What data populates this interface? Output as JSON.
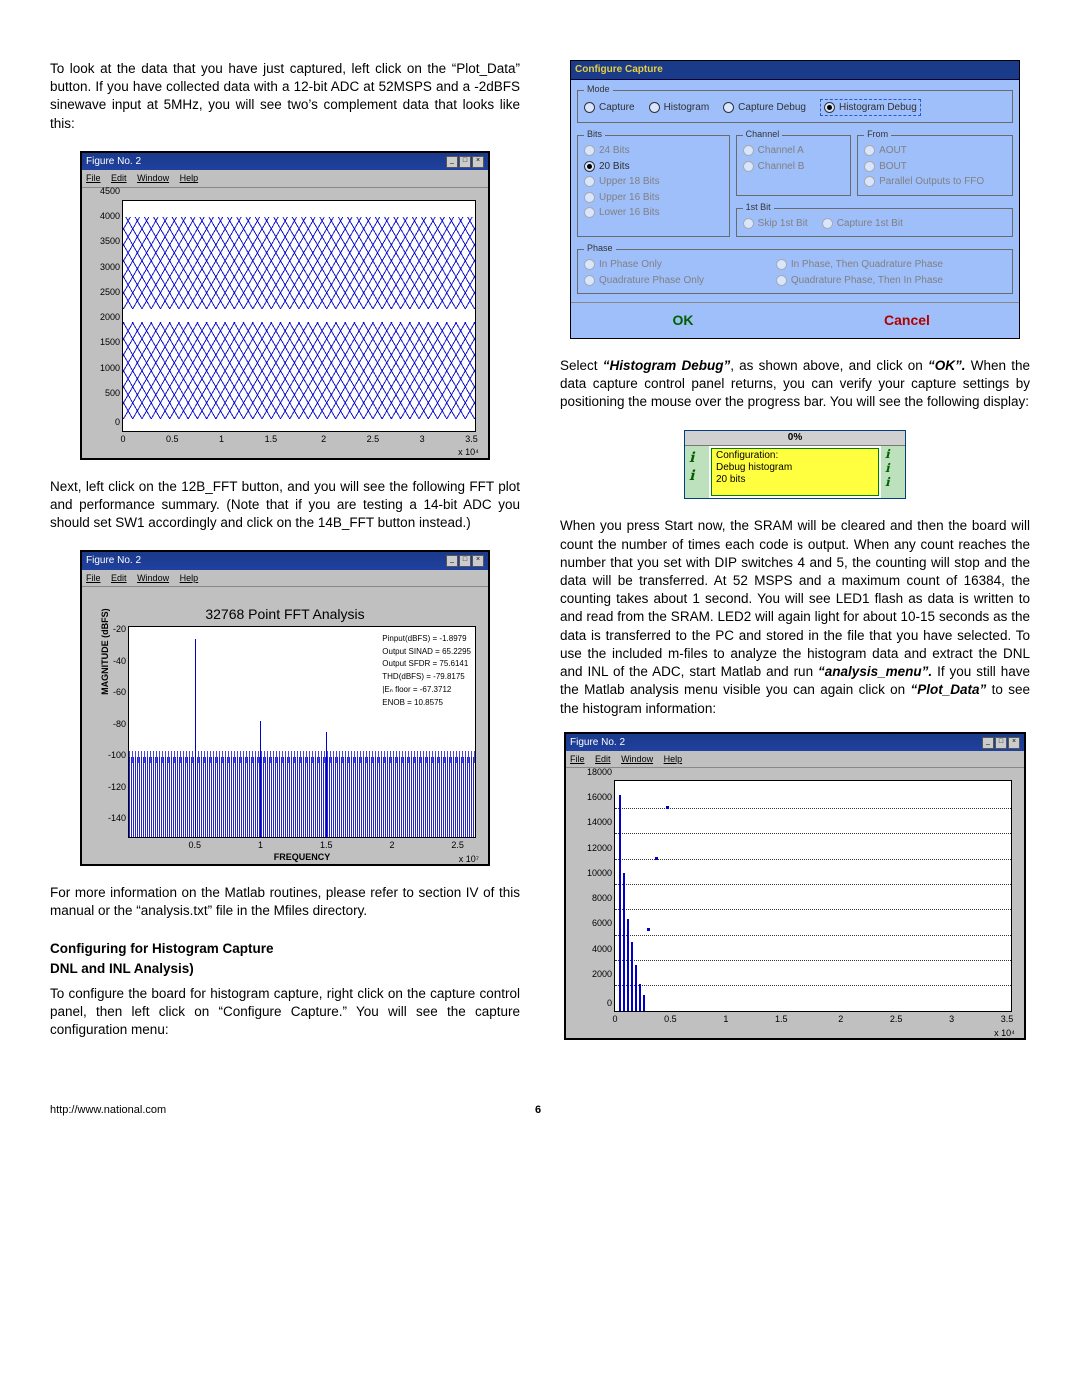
{
  "col1": {
    "p1": "To look at the data that you have just captured, left click on the “Plot_Data” button. If you have collected data with a 12-bit ADC at 52MSPS and a -2dBFS sinewave input at 5MHz, you will see two’s complement data that looks like this:",
    "fig1": {
      "title": "Figure No. 2",
      "menu": [
        "File",
        "Edit",
        "Window",
        "Help"
      ],
      "yticks": [
        "0",
        "500",
        "1000",
        "1500",
        "2000",
        "2500",
        "3000",
        "3500",
        "4000",
        "4500"
      ],
      "xticks": [
        "0",
        "0.5",
        "1",
        "1.5",
        "2",
        "2.5",
        "3",
        "3.5"
      ],
      "xexp": "x 10⁴"
    },
    "p2": "Next, left click on the 12B_FFT button, and you will see the following FFT plot and performance summary. (Note that if you are testing a 14-bit ADC you should set SW1 accordingly and click on the 14B_FFT button instead.)",
    "fig2": {
      "title": "Figure No. 2",
      "menu": [
        "File",
        "Edit",
        "Window",
        "Help"
      ],
      "plot_title": "32768 Point FFT Analysis",
      "ylabel": "MAGNITUDE (dBFS)",
      "xlabel": "FREQUENCY",
      "yticks": [
        "-140",
        "-120",
        "-100",
        "-80",
        "-60",
        "-40",
        "-20"
      ],
      "xticks": [
        "0.5",
        "1",
        "1.5",
        "2",
        "2.5"
      ],
      "xexp": "x 10⁷",
      "metrics": [
        "Pinput(dBFS) = -1.8979",
        "Output SINAD = 65.2295",
        "Output SFDR = 75.6141",
        "THD(dBFS) = -79.8175",
        "|Eₙ floor = -67.3712",
        "ENOB = 10.8575"
      ]
    },
    "p3": "For more information on the Matlab routines, please refer to section IV of this manual or the “analysis.txt” file in the Mfiles directory.",
    "h1a": "Configuring for Histogram Capture",
    "h1b": "DNL and INL Analysis)",
    "p4": "To configure the board for histogram capture, right click on the capture control panel, then left click on “Configure Capture.” You will see the capture configuration menu:"
  },
  "col2": {
    "cfg": {
      "title": "Configure Capture",
      "mode": {
        "label": "Mode",
        "items": [
          "Capture",
          "Histogram",
          "Capture Debug",
          "Histogram Debug"
        ],
        "selected": 3
      },
      "bits": {
        "label": "Bits",
        "items": [
          "24 Bits",
          "20 Bits",
          "Upper 18 Bits",
          "Upper 16 Bits",
          "Lower 16 Bits"
        ],
        "selected": 1
      },
      "channel": {
        "label": "Channel",
        "items": [
          "Channel A",
          "Channel B"
        ]
      },
      "from": {
        "label": "From",
        "items": [
          "AOUT",
          "BOUT",
          "Parallel Outputs to FFO"
        ]
      },
      "firstbit": {
        "label": "1st Bit",
        "items": [
          "Skip 1st Bit",
          "Capture 1st Bit"
        ]
      },
      "phase": {
        "label": "Phase",
        "items": [
          "In Phase Only",
          "Quadrature Phase Only",
          "In Phase, Then Quadrature Phase",
          "Quadrature Phase, Then In Phase"
        ]
      },
      "ok": "OK",
      "cancel": "Cancel"
    },
    "p1a": "Select ",
    "p1b": "“Histogram Debug”",
    "p1c": ", as shown above, and click on ",
    "p1d": "“OK”.",
    "p1e": " When the data capture control panel returns, you can verify your capture settings by positioning the mouse over the progress bar. You will see the following display:",
    "progress": {
      "pct": "0%",
      "lines": [
        "Configuration:",
        "Debug histogram",
        "20 bits"
      ]
    },
    "p2a": "When you press Start now, the SRAM will be cleared and then the board will count the number of times each code is output. When any count reaches the number that you set with DIP switches 4 and 5, the counting will stop and the data will be transferred. At 52 MSPS and a maximum count of 16384, the counting takes about 1 second. You will see LED1 flash as data is written to and read from the SRAM. LED2 will again light for about 10-15 seconds as the data is transferred to the PC and stored in the file that you have selected. To use the included m-files to analyze the histogram data and extract the DNL and INL of the ADC, start Matlab and run ",
    "p2b": "“analysis_menu”.",
    "p2c": " If you still have the Matlab analysis menu visible you can again click on ",
    "p2d": "“Plot_Data”",
    "p2e": " to see the histogram information:",
    "fig3": {
      "title": "Figure No. 2",
      "menu": [
        "File",
        "Edit",
        "Window",
        "Help"
      ],
      "yticks": [
        "0",
        "2000",
        "4000",
        "6000",
        "8000",
        "10000",
        "12000",
        "14000",
        "16000",
        "18000"
      ],
      "xticks": [
        "0",
        "0.5",
        "1",
        "1.5",
        "2",
        "2.5",
        "3",
        "3.5"
      ],
      "xexp": "x 10⁴"
    }
  },
  "footer": {
    "url": "http://www.national.com",
    "page": "6"
  },
  "chart_data": [
    {
      "type": "line",
      "name": "twos-complement-raw-data",
      "xlim": [
        0,
        35000
      ],
      "ylim": [
        0,
        4500
      ],
      "note": "5 MHz sine at -2 dBFS on 12-bit ADC @52 MSPS, two-band envelope roughly 0–2000 and 2100–4100"
    },
    {
      "type": "line",
      "name": "fft-analysis",
      "title": "32768 Point FFT Analysis",
      "xlabel": "FREQUENCY",
      "ylabel": "MAGNITUDE (dBFS)",
      "xlim": [
        0,
        26000000.0
      ],
      "ylim": [
        -150,
        -10
      ],
      "metrics": {
        "Pinput_dBFS": -1.8979,
        "SINAD": 65.2295,
        "SFDR": 75.6141,
        "THD_dBFS": -79.8175,
        "noisefloor": -67.3712,
        "ENOB": 10.8575
      },
      "fundamental_hz": 5000000.0
    },
    {
      "type": "bar",
      "name": "histogram",
      "xlim": [
        0,
        35000
      ],
      "ylim": [
        0,
        18000
      ],
      "note": "Counts concentrated near code 0–~2500 peaking ~17000 then sparse tail"
    }
  ]
}
